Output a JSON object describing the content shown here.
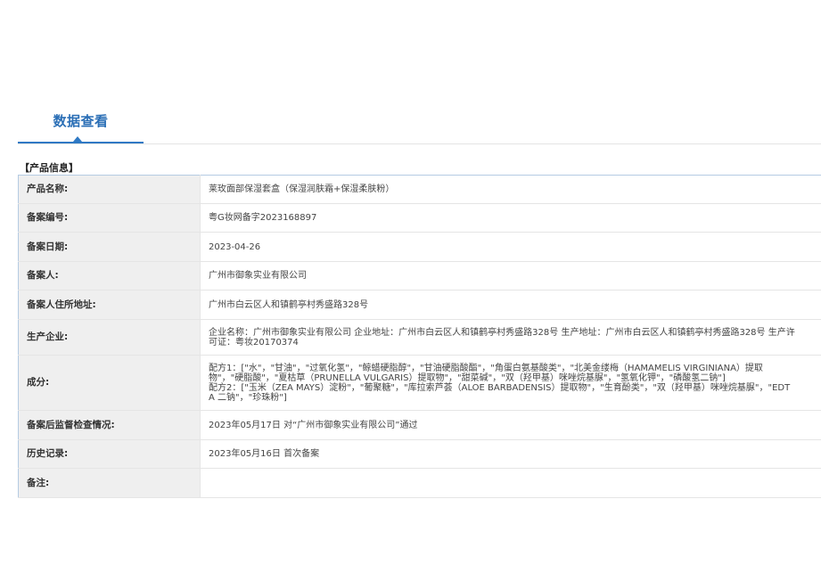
{
  "tabs": {
    "active_label": "数据查看"
  },
  "section": {
    "title": "【产品信息】"
  },
  "rows": [
    {
      "label": "产品名称:",
      "value": "莱玫面部保湿套盒（保湿润肤霜+保湿柔肤粉）"
    },
    {
      "label": "备案编号:",
      "value": "粤G妆网备字2023168897"
    },
    {
      "label": "备案日期:",
      "value": "2023-04-26"
    },
    {
      "label": "备案人:",
      "value": "广州市御象实业有限公司"
    },
    {
      "label": "备案人住所地址:",
      "value": "广州市白云区人和镇鹤亭村秀盛路328号"
    },
    {
      "label": "生产企业:",
      "value": "企业名称：广州市御象实业有限公司 企业地址：广州市白云区人和镇鹤亭村秀盛路328号 生产地址：广州市白云区人和镇鹤亭村秀盛路328号 生产许可证：粤妆20170374"
    },
    {
      "label": "成分:",
      "value_lines": [
        "配方1：[\"水\"，\"甘油\"，\"过氧化氢\"，\"鲸蜡硬脂醇\"，\"甘油硬脂酸酯\"，\"角蛋白氨基酸类\"，\"北美金缕梅（HAMAMELIS VIRGINIANA）提取物\"，\"硬脂酸\"，\"夏枯草（PRUNELLA VULGARIS）提取物\"，\"甜菜碱\"，\"双（羟甲基）咪唑烷基脲\"，\"氢氧化钾\"，\"磷酸氢二钠\"]",
        "配方2：[\"玉米（ZEA MAYS）淀粉\"，\"葡聚糖\"，\"库拉索芦荟（ALOE BARBADENSIS）提取物\"，\"生育酚类\"，\"双（羟甲基）咪唑烷基脲\"，\"EDTA 二钠\"，\"珍珠粉\"]"
      ]
    },
    {
      "label": "备案后监督检查情况:",
      "value": "2023年05月17日 对“广州市御象实业有限公司”通过"
    },
    {
      "label": "历史记录:",
      "value": "2023年05月16日 首次备案"
    },
    {
      "label": "备注:",
      "value": ""
    }
  ]
}
